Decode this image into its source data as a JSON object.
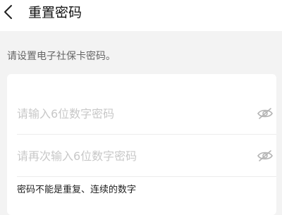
{
  "header": {
    "back_icon": "chevron-left-icon",
    "title": "重置密码"
  },
  "hint": "请设置电子社保卡密码。",
  "form": {
    "password_placeholder": "请输入6位数字密码",
    "confirm_placeholder": "请再次输入6位数字密码",
    "visibility_icon": "eye-off-icon",
    "rule_text": "密码不能是重复、连续的数字"
  },
  "colors": {
    "background": "#f3f3f3",
    "surface": "#ffffff",
    "placeholder": "#c8c8c8",
    "hint_text": "#666666"
  }
}
